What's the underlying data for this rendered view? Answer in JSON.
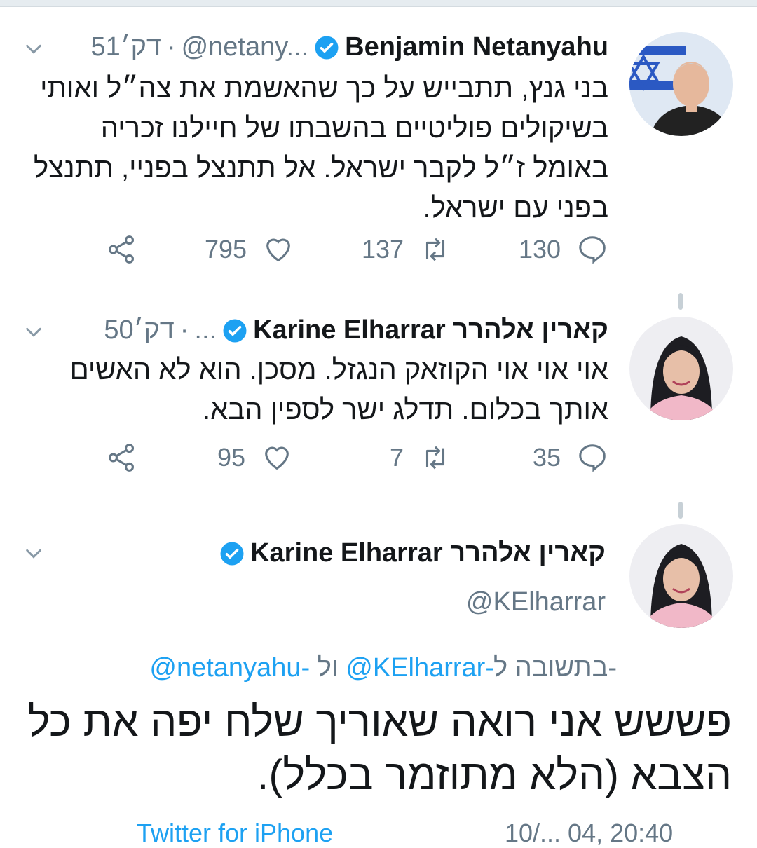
{
  "tweets": [
    {
      "name": "Benjamin Netanyahu",
      "handle": "@netany...",
      "separator": "·",
      "time": "51דק׳",
      "lines": [
        "בני גנץ, תתבייש על כך שהאשמת את צה״ל ואותי",
        "בשיקולים פוליטיים בהשבתו של חיילנו זכריה",
        "באומל ז״ל לקבר ישראל. אל תתנצל בפניי, תתנצל",
        "בפני עם ישראל."
      ],
      "replies": "130",
      "retweets": "137",
      "likes": "795"
    },
    {
      "name": "Karine Elharrar קארין אלהרר",
      "handle": "...",
      "separator": "·",
      "time": "50דק׳",
      "lines": [
        "אוי אוי אוי הקוזאק הנגזל. מסכן. הוא לא האשים",
        "אותך בכלום. תדלג ישר לספין הבא."
      ],
      "replies": "35",
      "retweets": "7",
      "likes": "95"
    }
  ],
  "main_tweet": {
    "name": "Karine Elharrar קארין אלהרר",
    "handle": "@KElharrar",
    "reply_prefix": "בתשובה ל-",
    "reply_handle_1": "@KElharrar-",
    "reply_join": " ול",
    "reply_handle_2": "@netanyahu-",
    "lines": [
      "פששש אני רואה שאוריך שלח יפה את כל",
      "הצבא (הלא מתוזמר בכלל)."
    ],
    "footer_source": "Twitter for iPhone",
    "footer_meta": "10/... 04, 20:40"
  },
  "colors": {
    "accent": "#1da1f2",
    "secondary_text": "#657786",
    "verified": "#1da1f2"
  }
}
